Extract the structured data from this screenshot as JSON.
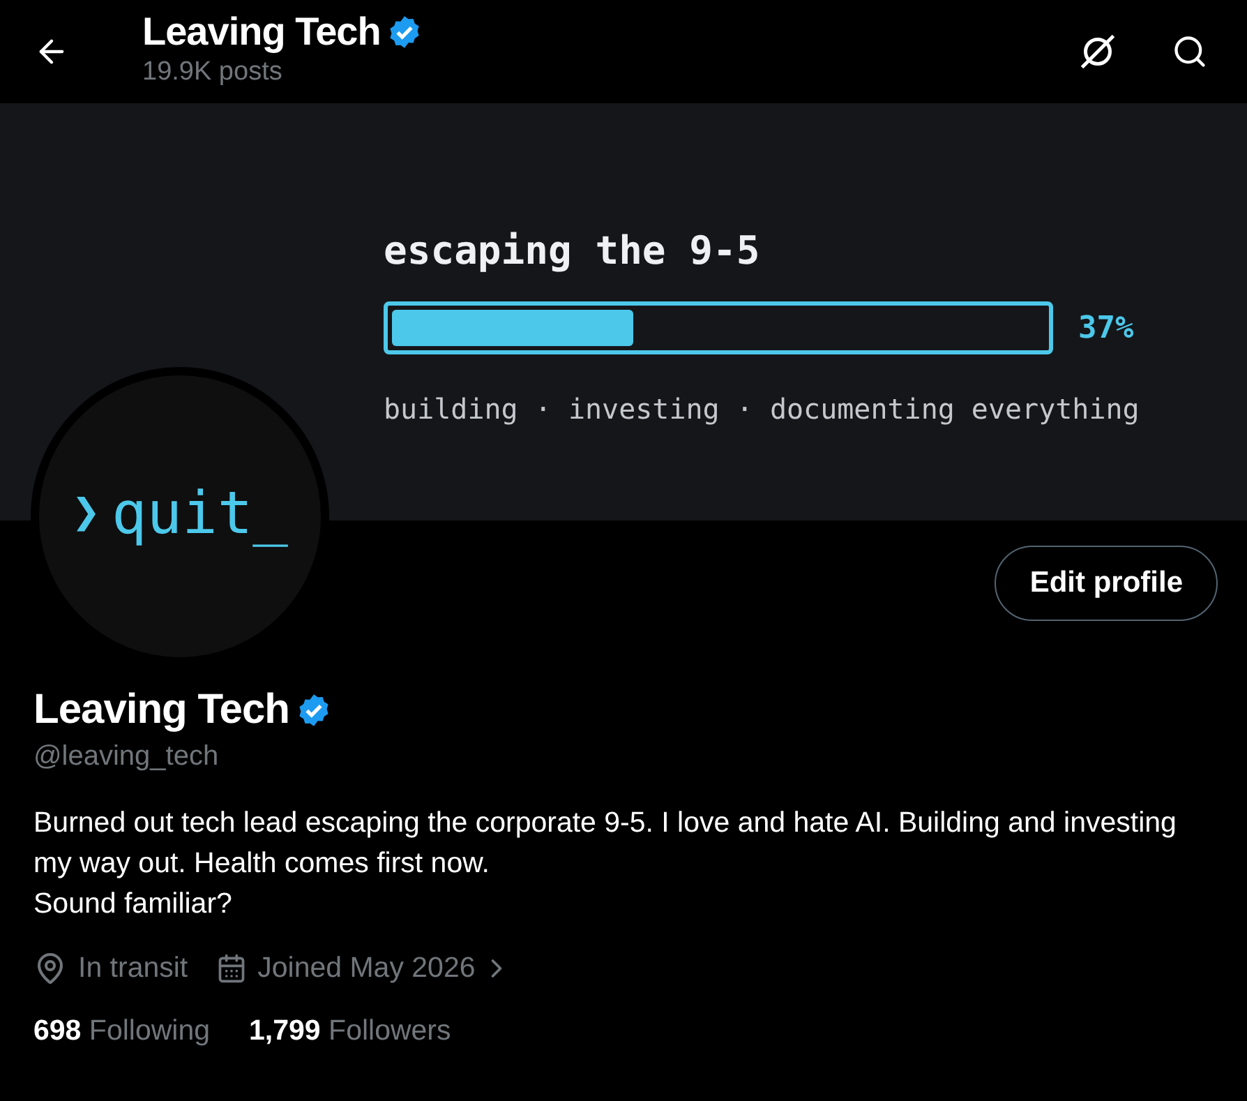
{
  "header": {
    "title": "Leaving Tech",
    "verified": true,
    "subtitle": "19.9K posts"
  },
  "banner": {
    "title": "escaping the 9-5",
    "progress": {
      "level": 0.37,
      "reading": "37%"
    },
    "tagline": "building · investing · documenting everything"
  },
  "avatar": {
    "prompt": "❯",
    "text": "quit_"
  },
  "edit_button": "Edit profile",
  "profile": {
    "name": "Leaving Tech",
    "verified": true,
    "handle": "@leaving_tech",
    "bio": [
      "Burned out tech lead escaping the corporate 9-5. I love and hate AI. Building and investing my way out. Health comes first now.",
      "Sound familiar?"
    ],
    "location": "In transit",
    "joined": "Joined May 2026"
  },
  "stats": [
    {
      "count": "698",
      "label": "Following"
    },
    {
      "count": "1,799",
      "label": "Followers"
    }
  ]
}
